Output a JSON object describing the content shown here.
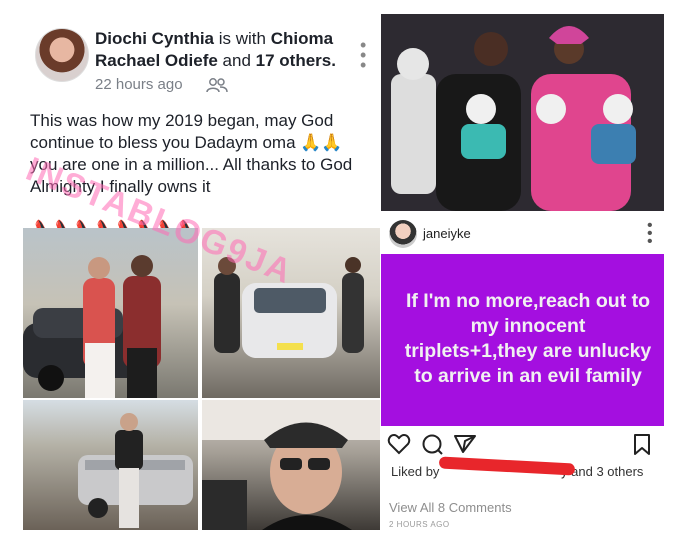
{
  "facebook_post": {
    "author": "Diochi Cynthia",
    "with_text": " is with ",
    "tagged": "Chioma Rachael Odiefe",
    "and_text": " and ",
    "others": "17 others.",
    "time": "22 hours ago",
    "text": "This was how my 2019 began, may God continue to bless you Dadaym oma 🙏🙏 you are one in a million... All thanks to God Almighty I finally owns it",
    "emojis": "👠👠👠👠👠👠👠👠",
    "watermark": "INSTABLOG9JA"
  },
  "instagram_post": {
    "username": "janeiyke",
    "message": "If I'm no more,reach out to my innocent triplets+1,they are unlucky to arrive in an evil family",
    "liked_by_prefix": "Liked by",
    "liked_by_suffix": "y and 3 others",
    "view_comments": "View All 8 Comments",
    "time_ago": "2 HOURS AGO"
  },
  "colors": {
    "ig_purple": "#a40fe0",
    "redaction": "#e8262b",
    "watermark": "#ff69b4"
  }
}
